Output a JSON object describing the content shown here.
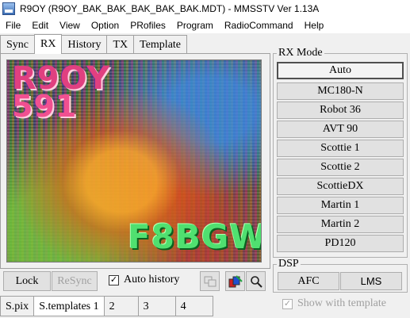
{
  "window": {
    "title": "R9OY (R9OY_BAK_BAK_BAK_BAK_BAK.MDT) - MMSSTV Ver 1.13A",
    "icon": "sstv-app-icon"
  },
  "menu": [
    "File",
    "Edit",
    "View",
    "Option",
    "PRofiles",
    "Program",
    "RadioCommand",
    "Help"
  ],
  "tabs": [
    "Sync",
    "RX",
    "History",
    "TX",
    "Template"
  ],
  "active_tab": "RX",
  "picture": {
    "call": "R9OY",
    "rst": "591",
    "sender": "F8BGW"
  },
  "controls": {
    "lock": "Lock",
    "resync": "ReSync",
    "auto_history": "Auto history",
    "auto_history_checked": "✓"
  },
  "bottom_tabs": [
    "S.pix",
    "S.templates 1",
    "2",
    "3",
    "4"
  ],
  "active_bottom_tab": "S.templates 1",
  "rx_mode": {
    "label": "RX Mode",
    "modes": [
      "Auto",
      "MC180-N",
      "Robot 36",
      "AVT 90",
      "Scottie 1",
      "Scottie 2",
      "ScottieDX",
      "Martin 1",
      "Martin 2",
      "PD120"
    ],
    "selected": "Auto"
  },
  "dsp": {
    "label": "DSP",
    "afc": "AFC",
    "lms": "LMS"
  },
  "show_with_template": {
    "label": "Show with template",
    "checked": "✓"
  }
}
